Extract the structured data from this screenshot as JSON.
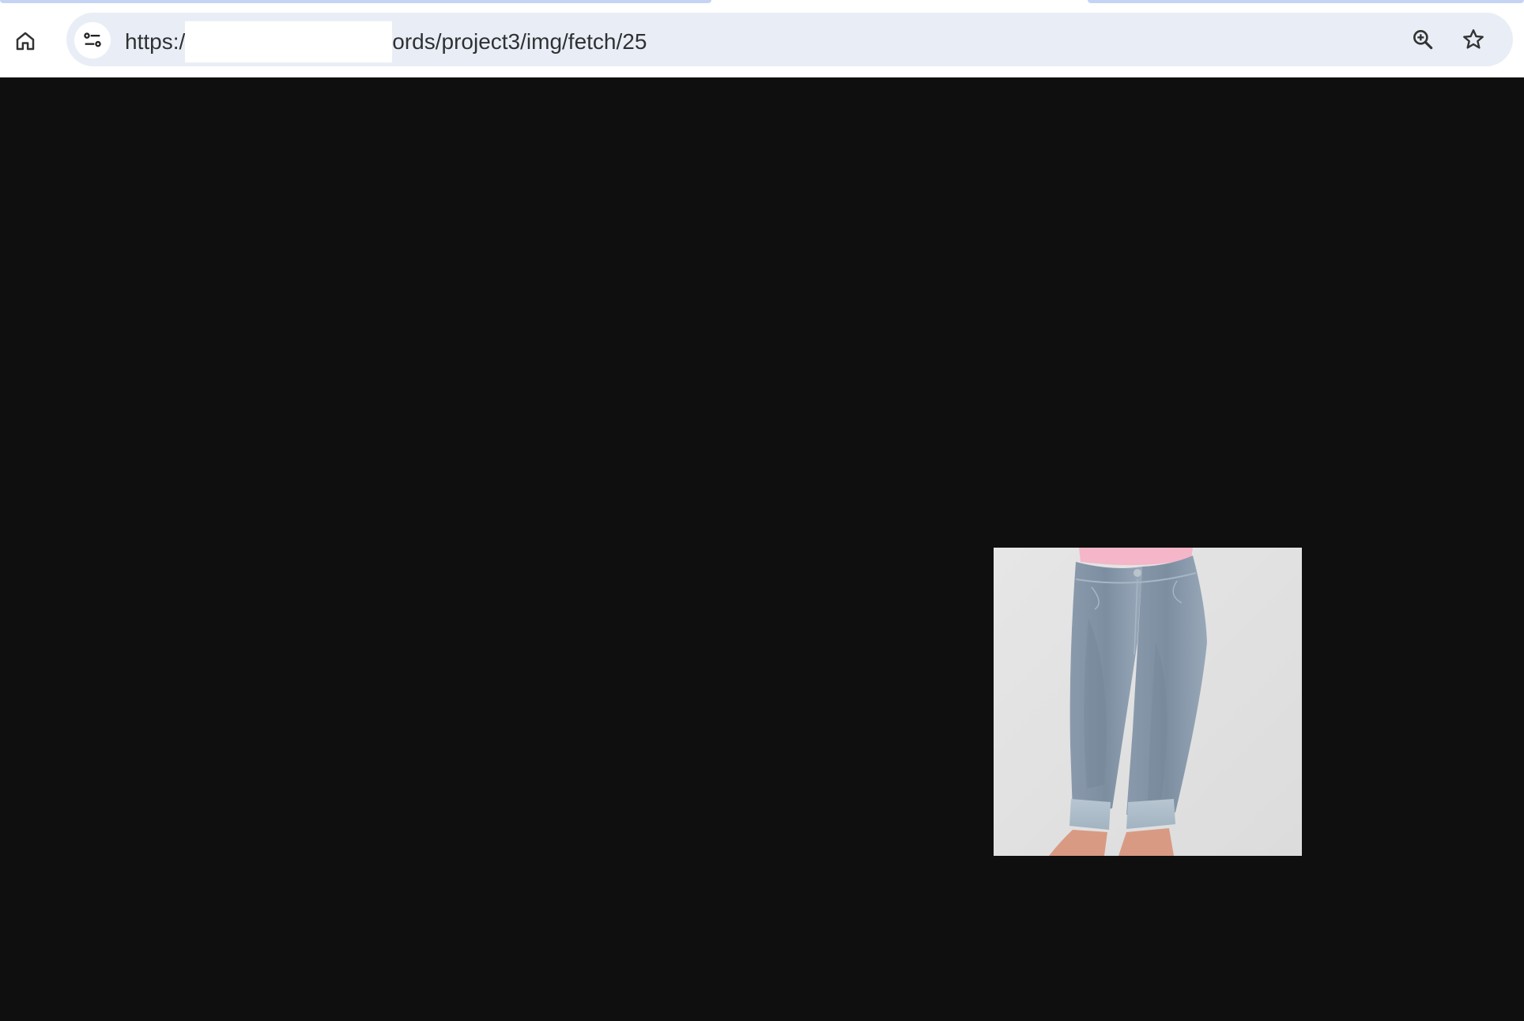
{
  "browser": {
    "url_prefix": "https:/",
    "url_suffix": "ords/project3/img/fetch/25",
    "icons": {
      "home": "home-icon",
      "site_info": "tune-icon",
      "zoom": "zoom-in-icon",
      "bookmark": "star-icon"
    }
  },
  "page": {
    "background": "#0f0f0f",
    "image": {
      "subject": "jeans-product-image"
    }
  }
}
